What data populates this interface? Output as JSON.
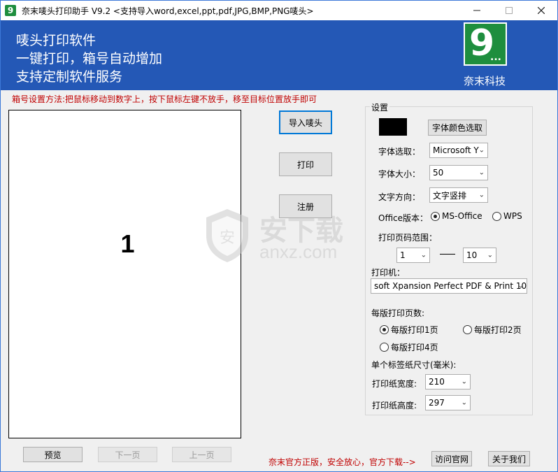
{
  "window": {
    "title": "奈末唛头打印助手  V9.2    <支持导入word,excel,ppt,pdf,JPG,BMP,PNG唛头>",
    "minimize_icon": "minimize-icon",
    "maximize_icon": "maximize-icon",
    "close_icon": "close-icon",
    "app_icon_text": "9"
  },
  "banner": {
    "line1": "唛头打印软件",
    "line2": "一键打印，箱号自动增加",
    "line3": "支持定制软件服务",
    "logo_text": "9",
    "logo_dots": "...",
    "company": "奈末科技"
  },
  "instruction": "箱号设置方法:把鼠标移动到数字上，按下鼠标左键不放手，移至目标位置放手即可",
  "preview": {
    "number": "1"
  },
  "watermark": {
    "text": "安下载",
    "sub": "anxz.com",
    "shield_glyph": "安"
  },
  "actions": {
    "import_label": "导入唛头",
    "print_label": "打印",
    "register_label": "注册"
  },
  "settings": {
    "title": "设置",
    "font_color_button": "字体颜色选取",
    "font_color": "#000000",
    "font_select_label": "字体选取：",
    "font_select_value": "Microsoft Y",
    "font_size_label": "字体大小：",
    "font_size_value": "50",
    "text_direction_label": "文字方向：",
    "text_direction_value": "文字竖排",
    "office_label": "Office版本：",
    "office_options": [
      "MS-Office",
      "WPS"
    ],
    "office_selected": "MS-Office",
    "page_range_label": "打印页码范围：",
    "page_from": "1",
    "page_to": "10",
    "printer_label": "打印机：",
    "printer_value": "soft Xpansion Perfect PDF & Print 10",
    "pages_per_sheet_label": "每版打印页数:",
    "pages_per_sheet_options": [
      "每版打印1页",
      "每版打印2页",
      "每版打印4页"
    ],
    "pages_per_sheet_selected": "每版打印1页",
    "label_size_label": "单个标签纸尺寸(毫米):",
    "paper_width_label": "打印纸宽度:",
    "paper_width_value": "210",
    "paper_height_label": "打印纸高度:",
    "paper_height_value": "297"
  },
  "nav": {
    "preview_label": "预览",
    "next_label": "下一页",
    "prev_label": "上一页"
  },
  "footer": {
    "notice": "奈末官方正版，安全放心，官方下载-->",
    "visit_label": "访问官网",
    "about_label": "关于我们"
  }
}
